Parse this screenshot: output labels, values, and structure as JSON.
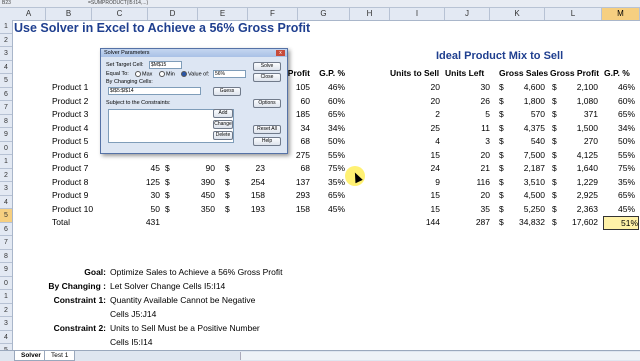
{
  "formula_bar": {
    "name_box": "B23",
    "formula": "=SUMPRODUCT(I5:I14,...)"
  },
  "columns": [
    "A",
    "B",
    "C",
    "D",
    "E",
    "F",
    "G",
    "H",
    "I",
    "J",
    "K",
    "L",
    "M"
  ],
  "rows": [
    "1",
    "2",
    "3",
    "4",
    "5",
    "6",
    "7",
    "8",
    "9",
    "0",
    "1",
    "2",
    "3",
    "4",
    "5",
    "6",
    "7",
    "8",
    "9",
    "0",
    "1",
    "2",
    "3",
    "4",
    "5"
  ],
  "title": "Use Solver in Excel to Achieve a 56% Gross Profit",
  "left_headers": {
    "profit": "Profit",
    "gp": "G.P. %"
  },
  "products": [
    {
      "name": "Product 1",
      "c": "",
      "d": "",
      "e": "",
      "profit": "105",
      "gp": "46%"
    },
    {
      "name": "Product 2",
      "c": "",
      "d": "",
      "e": "",
      "profit": "60",
      "gp": "60%"
    },
    {
      "name": "Product 3",
      "c": "",
      "d": "",
      "e": "",
      "profit": "185",
      "gp": "65%"
    },
    {
      "name": "Product 4",
      "c": "",
      "d": "",
      "e": "",
      "profit": "34",
      "gp": "34%"
    },
    {
      "name": "Product 5",
      "c": "",
      "d": "",
      "e": "",
      "profit": "68",
      "gp": "50%"
    },
    {
      "name": "Product 6",
      "c": "",
      "d": "",
      "e": "",
      "profit": "275",
      "gp": "55%"
    },
    {
      "name": "Product 7",
      "c": "45",
      "d": "90",
      "e": "23",
      "profit": "68",
      "gp": "75%"
    },
    {
      "name": "Product 8",
      "c": "125",
      "d": "390",
      "e": "254",
      "profit": "137",
      "gp": "35%"
    },
    {
      "name": "Product 9",
      "c": "30",
      "d": "450",
      "e": "158",
      "profit": "293",
      "gp": "65%"
    },
    {
      "name": "Product 10",
      "c": "50",
      "d": "350",
      "e": "193",
      "profit": "158",
      "gp": "45%"
    }
  ],
  "total": {
    "label": "Total",
    "c": "431"
  },
  "currency": "$",
  "ideal_title": "Ideal Product Mix to Sell",
  "ideal_headers": {
    "units": "Units to Sell",
    "left": "Units Left",
    "sales": "Gross Sales",
    "profit": "Gross Profit",
    "gp": "G.P. %"
  },
  "ideal_rows": [
    {
      "units": "20",
      "left": "30",
      "sales": "4,600",
      "profit": "2,100",
      "gp": "46%"
    },
    {
      "units": "20",
      "left": "26",
      "sales": "1,800",
      "profit": "1,080",
      "gp": "60%"
    },
    {
      "units": "2",
      "left": "5",
      "sales": "570",
      "profit": "371",
      "gp": "65%"
    },
    {
      "units": "25",
      "left": "11",
      "sales": "4,375",
      "profit": "1,500",
      "gp": "34%"
    },
    {
      "units": "4",
      "left": "3",
      "sales": "540",
      "profit": "270",
      "gp": "50%"
    },
    {
      "units": "15",
      "left": "20",
      "sales": "7,500",
      "profit": "4,125",
      "gp": "55%"
    },
    {
      "units": "24",
      "left": "21",
      "sales": "2,187",
      "profit": "1,640",
      "gp": "75%"
    },
    {
      "units": "9",
      "left": "116",
      "sales": "3,510",
      "profit": "1,229",
      "gp": "35%"
    },
    {
      "units": "15",
      "left": "20",
      "sales": "4,500",
      "profit": "2,925",
      "gp": "65%"
    },
    {
      "units": "15",
      "left": "35",
      "sales": "5,250",
      "profit": "2,363",
      "gp": "45%"
    }
  ],
  "ideal_total": {
    "units": "144",
    "left": "287",
    "sales": "34,832",
    "profit": "17,602",
    "gp": "51%"
  },
  "notes": [
    {
      "label": "Goal:",
      "text": "Optimize Sales to Achieve a 56% Gross Profit"
    },
    {
      "label": "By Changing :",
      "text": "Let Solver Change Cells I5:I14"
    },
    {
      "label": "Constraint 1:",
      "text": "Quantity Available Cannot be Negative"
    },
    {
      "label": "",
      "text": "Cells J5:J14"
    },
    {
      "label": "Constraint 2:",
      "text": "Units to Sell Must be a Positive Number"
    },
    {
      "label": "",
      "text": "Cells I5:I14"
    }
  ],
  "dialog": {
    "title": "Solver Parameters",
    "close": "x",
    "target_label": "Set Target Cell:",
    "target_value": "$M$15",
    "equal_label": "Equal To:",
    "opt_max": "Max",
    "opt_min": "Min",
    "opt_value": "Value of:",
    "value_of": "56%",
    "changing_label": "By Changing Cells:",
    "changing_value": "$I$5:$I$14",
    "guess": "Guess",
    "constraints_label": "Subject to the Constraints:",
    "btn_solve": "Solve",
    "btn_close": "Close",
    "btn_options": "Options",
    "btn_add": "Add",
    "btn_change": "Change",
    "btn_delete": "Delete",
    "btn_reset": "Reset All",
    "btn_help": "Help"
  },
  "tabs": [
    "Solver",
    "Test 1"
  ]
}
